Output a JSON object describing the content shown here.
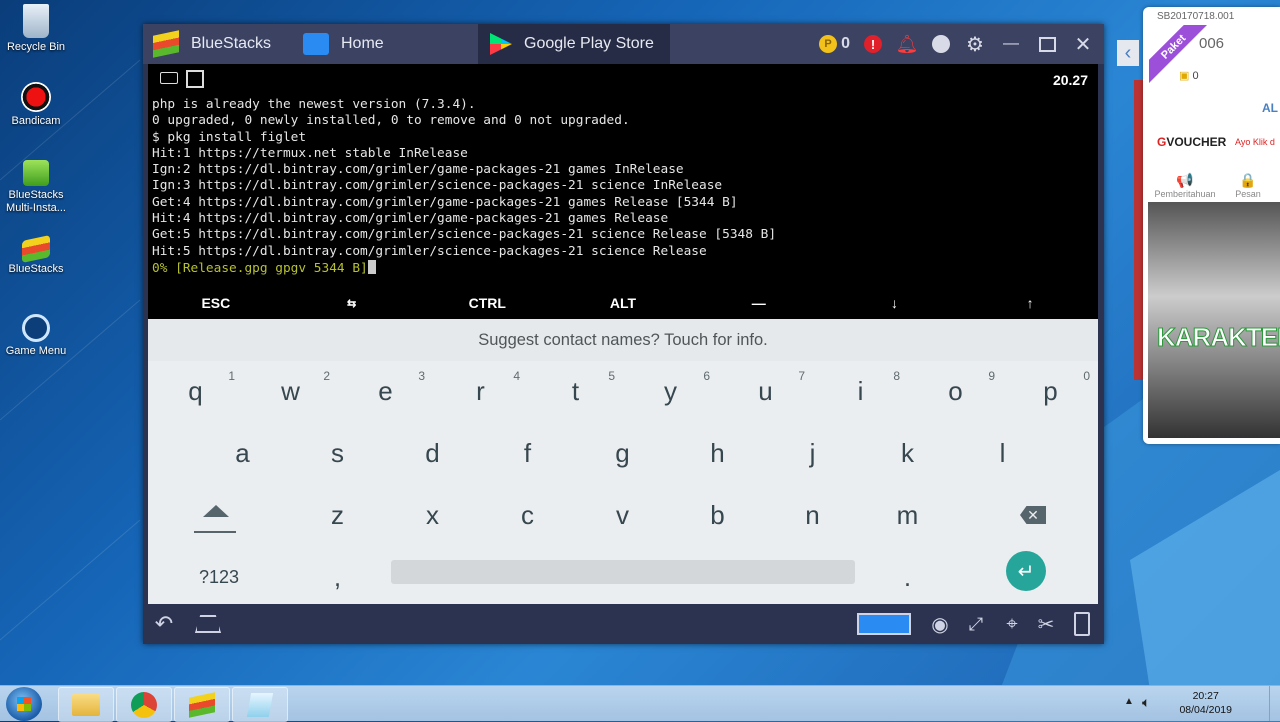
{
  "desktop": {
    "icons": [
      {
        "label": "Recycle Bin",
        "icon": "recycle-bin-icon"
      },
      {
        "label": "Bandicam",
        "icon": "bandicam-icon"
      },
      {
        "label": "BlueStacks Multi-Insta...",
        "icon": "bluestacks-multi-icon"
      },
      {
        "label": "BlueStacks",
        "icon": "bluestacks-icon"
      },
      {
        "label": "Game Menu",
        "icon": "game-menu-icon"
      }
    ]
  },
  "window": {
    "tabs": [
      {
        "label": "BlueStacks"
      },
      {
        "label": "Home"
      },
      {
        "label": "Google Play Store"
      }
    ],
    "coins": "0"
  },
  "android": {
    "clock": "20.27",
    "terminal_lines": [
      "php is already the newest version (7.3.4).",
      "0 upgraded, 0 newly installed, 0 to remove and 0 not upgraded.",
      "$ pkg install figlet",
      "Hit:1 https://termux.net stable InRelease",
      "Ign:2 https://dl.bintray.com/grimler/game-packages-21 games InRelease",
      "Ign:3 https://dl.bintray.com/grimler/science-packages-21 science InRelease",
      "Get:4 https://dl.bintray.com/grimler/game-packages-21 games Release [5344 B]",
      "Hit:4 https://dl.bintray.com/grimler/game-packages-21 games Release",
      "Get:5 https://dl.bintray.com/grimler/science-packages-21 science Release [5348 B]",
      "Hit:5 https://dl.bintray.com/grimler/science-packages-21 science Release"
    ],
    "progress_line": "0% [Release.gpg gpgv 5344 B]",
    "extra_keys": [
      "ESC",
      "⇆",
      "CTRL",
      "ALT",
      "—",
      "↓",
      "↑"
    ],
    "keyboard": {
      "suggestion": "Suggest contact names? Touch for info.",
      "row1": [
        {
          "k": "q",
          "n": "1"
        },
        {
          "k": "w",
          "n": "2"
        },
        {
          "k": "e",
          "n": "3"
        },
        {
          "k": "r",
          "n": "4"
        },
        {
          "k": "t",
          "n": "5"
        },
        {
          "k": "y",
          "n": "6"
        },
        {
          "k": "u",
          "n": "7"
        },
        {
          "k": "i",
          "n": "8"
        },
        {
          "k": "o",
          "n": "9"
        },
        {
          "k": "p",
          "n": "0"
        }
      ],
      "row2": [
        "a",
        "s",
        "d",
        "f",
        "g",
        "h",
        "j",
        "k",
        "l"
      ],
      "row3": [
        "z",
        "x",
        "c",
        "v",
        "b",
        "n",
        "m"
      ],
      "symbols_label": "?123",
      "comma": ",",
      "period": "."
    }
  },
  "side_panel": {
    "id": "SB20170718.001",
    "ribbon": "Paket",
    "number": "006",
    "coins": "0",
    "al": "AL",
    "voucher_brand": "VOUCHER",
    "voucher_g": "G",
    "voucher_cta": "Ayo Klik d",
    "tab_notifications": "Pemberitahuan",
    "tab_messages": "Pesan",
    "banner_text": "KARAKTER"
  },
  "taskbar": {
    "time": "20:27",
    "date": "08/04/2019"
  },
  "colors": {
    "accent_teal": "#26a69a",
    "titlebar": "#3b4262",
    "terminal_progress": "#b7c12f"
  }
}
